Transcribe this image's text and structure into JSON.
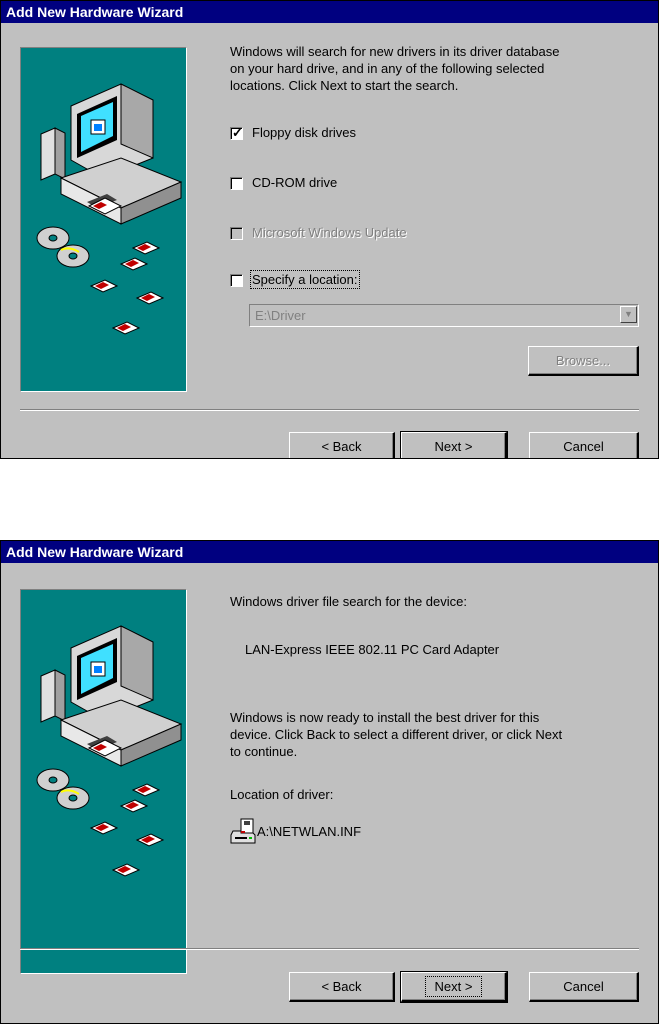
{
  "wizard1": {
    "title": "Add New Hardware Wizard",
    "intro_line1": "Windows will search for new drivers in its driver database",
    "intro_line2": "on your hard drive, and in any of the following selected",
    "intro_line3": "locations. Click Next to start the search.",
    "options": [
      {
        "label": "Floppy disk drives",
        "checked": true,
        "enabled": true
      },
      {
        "label": "CD-ROM drive",
        "checked": false,
        "enabled": true
      },
      {
        "label": "Microsoft Windows Update",
        "checked": false,
        "enabled": false
      },
      {
        "label": "Specify a location:",
        "checked": false,
        "enabled": true
      }
    ],
    "location_value": "E:\\Driver",
    "browse_label": "Browse...",
    "back_label": "< Back",
    "next_label": "Next >",
    "cancel_label": "Cancel"
  },
  "wizard2": {
    "title": "Add New Hardware Wizard",
    "search_heading": "Windows driver file search for the device:",
    "device_name": "LAN-Express IEEE 802.11 PC Card Adapter",
    "ready_line1": "Windows is now ready to install the best driver for this",
    "ready_line2": "device. Click Back to select a different driver, or click Next",
    "ready_line3": "to continue.",
    "location_heading": "Location of driver:",
    "driver_path": "A:\\NETWLAN.INF",
    "back_label": "< Back",
    "next_label": "Next >",
    "cancel_label": "Cancel"
  },
  "colors": {
    "face": "#c0c0c0",
    "titlebar": "#000080",
    "art_bg": "#008080"
  },
  "icons": [
    "computer-illustration",
    "cd-disc-icon",
    "floppy-disk-icon",
    "floppy-drive-icon",
    "checkmark-icon",
    "dropdown-arrow-icon"
  ]
}
